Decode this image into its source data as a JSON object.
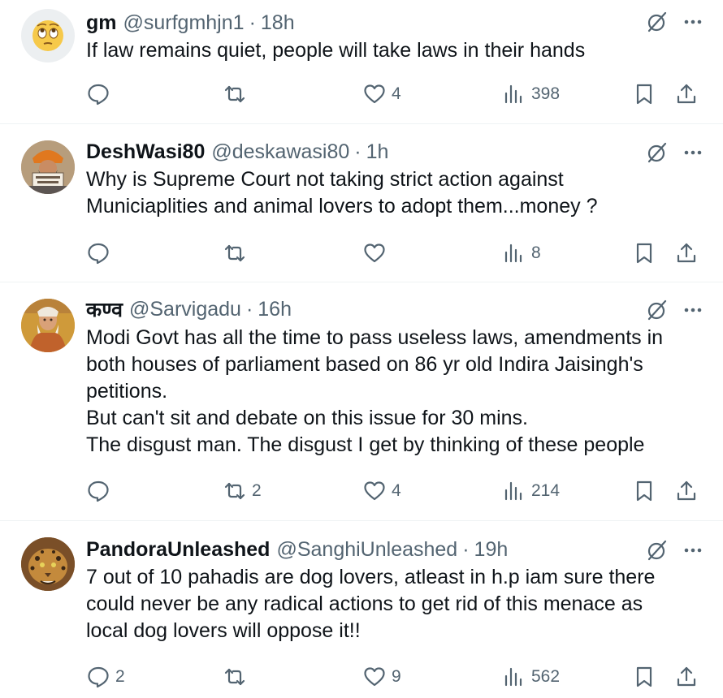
{
  "tweets": [
    {
      "name": "gm",
      "handle": "@surfgmhjn1",
      "time": "18h",
      "avatar": "rolling-eyes-emoji-avatar",
      "text": [
        "If law remains quiet, people will take laws in their hands"
      ],
      "replies": "",
      "retweets": "",
      "likes": "4",
      "views": "398"
    },
    {
      "name": "DeshWasi80",
      "handle": "@deskawasi80",
      "time": "1h",
      "avatar": "turbaned-man-avatar",
      "text": [
        "Why is Supreme Court not taking strict action against",
        "Municiaplities and animal lovers to adopt them...money ?"
      ],
      "replies": "",
      "retweets": "",
      "likes": "",
      "views": "8"
    },
    {
      "name": "कण्व",
      "handle": "@Sarvigadu",
      "time": "16h",
      "avatar": "sage-painting-avatar",
      "text": [
        "Modi Govt has all the time to pass useless laws, amendments in",
        "both houses of parliament based on 86 yr old Indira Jaisingh's",
        "petitions.",
        "But can't sit and debate on this issue for 30 mins.",
        "The disgust man. The disgust I get by thinking of these people"
      ],
      "replies": "",
      "retweets": "2",
      "likes": "4",
      "views": "214"
    },
    {
      "name": "PandoraUnleashed",
      "handle": "@SanghiUnleashed",
      "time": "19h",
      "avatar": "leopard-avatar",
      "text": [
        "7 out of 10 pahadis are dog lovers, atleast in h.p iam sure there",
        "could never be any radical actions to get rid of this menace as",
        "local dog lovers will oppose it!!"
      ],
      "replies": "2",
      "retweets": "",
      "likes": "9",
      "views": "562"
    }
  ],
  "icons": {
    "reply": "reply-icon",
    "retweet": "retweet-icon",
    "like": "heart-icon",
    "views": "views-icon",
    "bookmark": "bookmark-icon",
    "share": "share-icon",
    "grok": "grok-icon",
    "more": "more-icon"
  },
  "colors": {
    "text": "#0f1419",
    "muted": "#536471",
    "divider": "#eff3f4"
  }
}
